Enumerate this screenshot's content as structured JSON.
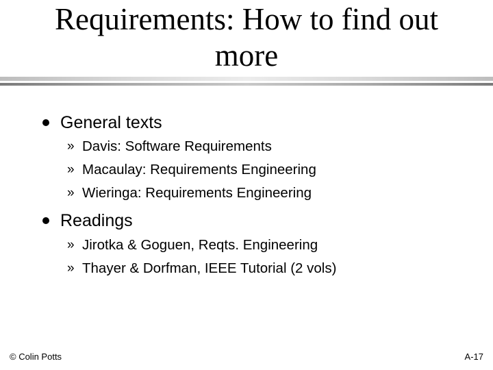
{
  "slide": {
    "title_line1": "Requirements: How to find out",
    "title_line2": "more",
    "sections": [
      {
        "label": "General texts",
        "items": [
          "Davis: Software Requirements",
          "Macaulay: Requirements Engineering",
          "Wieringa: Requirements Engineering"
        ]
      },
      {
        "label": "Readings",
        "items": [
          "Jirotka & Goguen, Reqts. Engineering",
          "Thayer & Dorfman, IEEE Tutorial (2 vols)"
        ]
      }
    ],
    "sub_marker": "»",
    "footer": {
      "copyright": "© Colin Potts",
      "page_number": "A-17"
    }
  }
}
